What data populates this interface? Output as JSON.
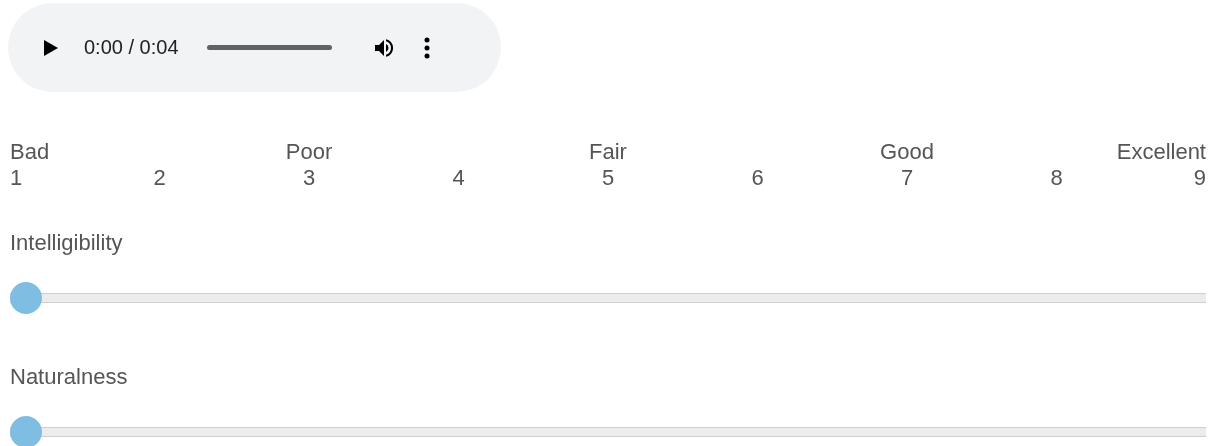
{
  "audio_player": {
    "time": "0:00 / 0:04"
  },
  "scale": {
    "labels": [
      "Bad",
      "Poor",
      "Fair",
      "Good",
      "Excellent"
    ],
    "numbers": [
      "1",
      "2",
      "3",
      "4",
      "5",
      "6",
      "7",
      "8",
      "9"
    ]
  },
  "sliders": [
    {
      "label": "Intelligibility",
      "level": 0
    },
    {
      "label": "Naturalness",
      "level": 0
    }
  ]
}
